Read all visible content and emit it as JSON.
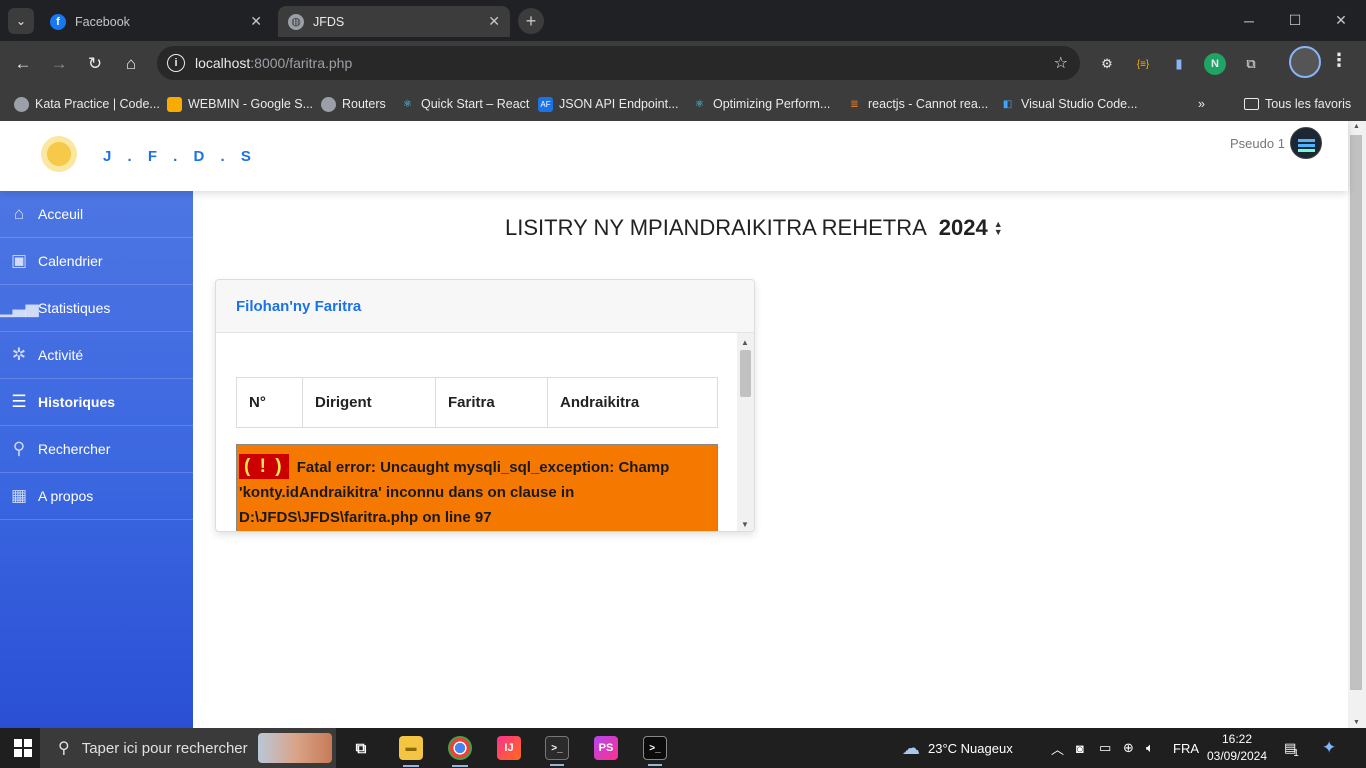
{
  "browser": {
    "tabs": [
      {
        "title": "Facebook",
        "icon": "facebook-icon",
        "active": false
      },
      {
        "title": "JFDS",
        "icon": "globe-icon",
        "active": true
      }
    ],
    "address": {
      "host": "localhost",
      "path": ":8000/faritra.php"
    },
    "bookmarks": [
      {
        "label": "Kata Practice | Code...",
        "icon": "globe-icon"
      },
      {
        "label": "WEBMIN - Google S...",
        "icon": "slides-icon"
      },
      {
        "label": "Routers",
        "icon": "globe-icon"
      },
      {
        "label": "Quick Start – React",
        "icon": "react-icon"
      },
      {
        "label": "JSON API Endpoint...",
        "icon": "api-icon"
      },
      {
        "label": "Optimizing Perform...",
        "icon": "react-icon"
      },
      {
        "label": "reactjs - Cannot rea...",
        "icon": "stackoverflow-icon"
      },
      {
        "label": "Visual Studio Code...",
        "icon": "vscode-icon"
      }
    ],
    "all_bookmarks": "Tous les favoris"
  },
  "app": {
    "brand": "J . F . D . S",
    "user": "Pseudo 1",
    "sidebar": [
      {
        "label": "Acceuil",
        "icon": "home-icon",
        "active": false
      },
      {
        "label": "Calendrier",
        "icon": "calendar-icon",
        "active": false
      },
      {
        "label": "Statistiques",
        "icon": "bar-chart-icon",
        "active": false
      },
      {
        "label": "Activité",
        "icon": "activity-icon",
        "active": false
      },
      {
        "label": "Historiques",
        "icon": "history-icon",
        "active": true
      },
      {
        "label": "Rechercher",
        "icon": "search-icon",
        "active": false
      },
      {
        "label": "A propos",
        "icon": "building-icon",
        "active": false
      }
    ],
    "heading": "LISITRY NY MPIANDRAIKITRA REHETRA",
    "year": "2024",
    "card_title": "Filohan'ny Faritra",
    "table_headers": [
      "N°",
      "Dirigent",
      "Faritra",
      "Andraikitra"
    ],
    "error": {
      "badge": "( ! )",
      "message": "Fatal error: Uncaught mysqli_sql_exception: Champ 'konty.idAndraikitra' inconnu dans on clause in D:\\JFDS\\JFDS\\faritra.php on line 97"
    }
  },
  "taskbar": {
    "search_placeholder": "Taper ici pour rechercher",
    "weather": "23°C  Nuageux",
    "language": "FRA",
    "time": "16:22",
    "date": "03/09/2024",
    "notification_count": "1"
  }
}
